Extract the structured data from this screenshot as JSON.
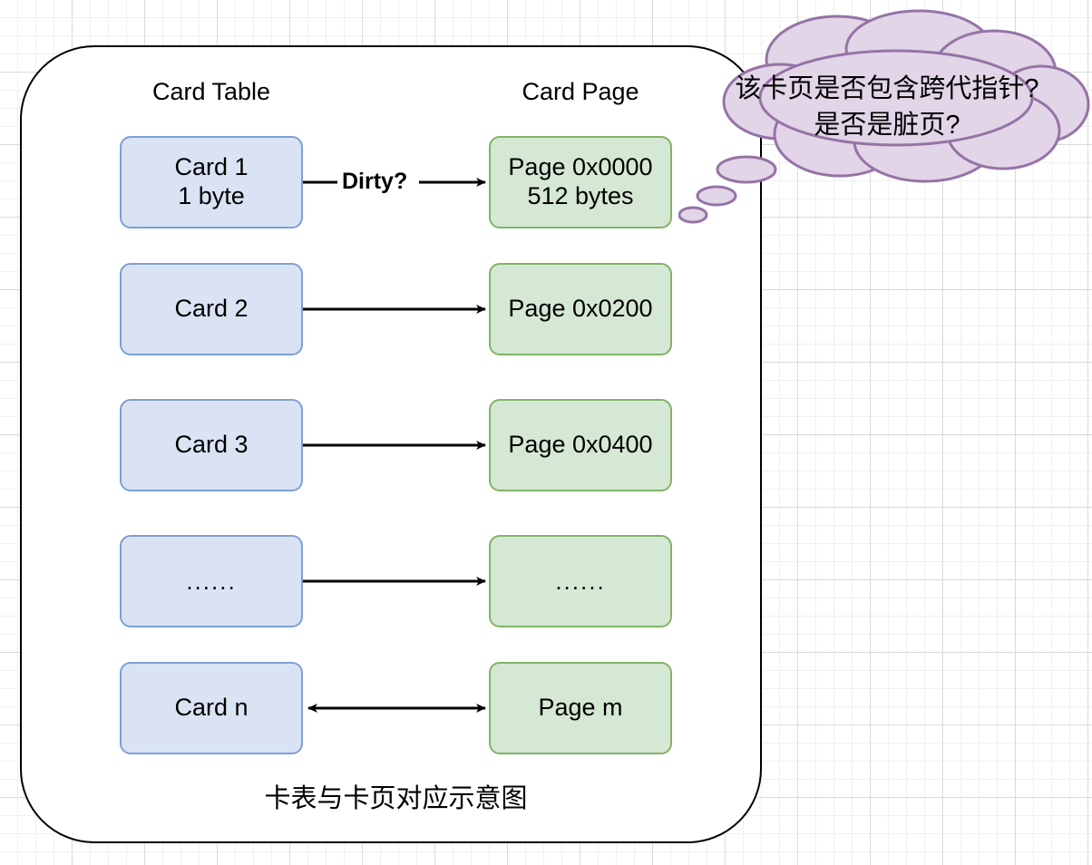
{
  "diagram": {
    "caption": "卡表与卡页对应示意图",
    "columns": {
      "left_header": "Card Table",
      "right_header": "Card Page"
    },
    "edge_labels": {
      "row1": "Dirty?"
    },
    "rows": [
      {
        "card_line1": "Card 1",
        "card_line2": "1 byte",
        "page_line1": "Page 0x0000",
        "page_line2": "512 bytes",
        "arrow": "single-right",
        "label": "Dirty?"
      },
      {
        "card_line1": "Card 2",
        "card_line2": "",
        "page_line1": "Page 0x0200",
        "page_line2": "",
        "arrow": "single-right",
        "label": ""
      },
      {
        "card_line1": "Card 3",
        "card_line2": "",
        "page_line1": "Page 0x0400",
        "page_line2": "",
        "arrow": "single-right",
        "label": ""
      },
      {
        "card_line1": "......",
        "card_line2": "",
        "page_line1": "......",
        "page_line2": "",
        "arrow": "single-right",
        "label": ""
      },
      {
        "card_line1": "Card n",
        "card_line2": "",
        "page_line1": "Page m",
        "page_line2": "",
        "arrow": "double",
        "label": ""
      }
    ],
    "thought_bubble": {
      "line1": "该卡页是否包含跨代指针?",
      "line2": "是否是脏页?"
    },
    "colors": {
      "card_fill": "#dae3f3",
      "card_stroke": "#7da0d4",
      "page_fill": "#d5e8d4",
      "page_stroke": "#82b366",
      "cloud_fill": "#e1d5e7",
      "cloud_stroke": "#9673a6",
      "frame_stroke": "#000000",
      "grid_minor": "#f0f0f0",
      "grid_major": "#d9d9d9"
    }
  }
}
